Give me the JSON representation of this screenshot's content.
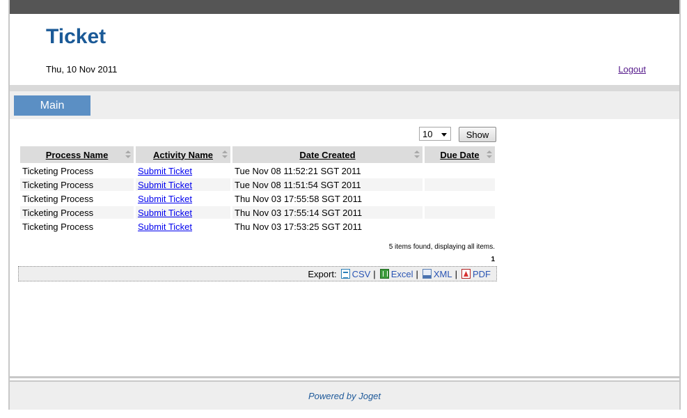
{
  "header": {
    "title": "Ticket",
    "date": "Thu, 10 Nov 2011",
    "logout_label": "Logout"
  },
  "menu": {
    "tabs": [
      {
        "label": "Main"
      }
    ]
  },
  "controls": {
    "page_size": "10",
    "show_label": "Show"
  },
  "table": {
    "columns": [
      "Process Name",
      "Activity Name",
      "Date Created",
      "Due Date"
    ],
    "rows": [
      {
        "process": "Ticketing Process",
        "activity": "Submit Ticket",
        "created": "Tue Nov 08 11:52:21 SGT 2011",
        "due": ""
      },
      {
        "process": "Ticketing Process",
        "activity": "Submit Ticket",
        "created": "Tue Nov 08 11:51:54 SGT 2011",
        "due": ""
      },
      {
        "process": "Ticketing Process",
        "activity": "Submit Ticket",
        "created": "Thu Nov 03 17:55:58 SGT 2011",
        "due": ""
      },
      {
        "process": "Ticketing Process",
        "activity": "Submit Ticket",
        "created": "Thu Nov 03 17:55:14 SGT 2011",
        "due": ""
      },
      {
        "process": "Ticketing Process",
        "activity": "Submit Ticket",
        "created": "Thu Nov 03 17:53:25 SGT 2011",
        "due": ""
      }
    ],
    "items_found": "5 items found, displaying all items.",
    "page": "1"
  },
  "export": {
    "label": "Export:",
    "separator": "|",
    "options": [
      {
        "label": "CSV",
        "icon": "csv-icon"
      },
      {
        "label": "Excel",
        "icon": "excel-icon"
      },
      {
        "label": "XML",
        "icon": "xml-icon"
      },
      {
        "label": "PDF",
        "icon": "pdf-icon"
      }
    ]
  },
  "footer": {
    "text": "Powered by Joget"
  },
  "colors": {
    "topbar": "#555555",
    "title": "#1b5a97",
    "tab_active": "#5b8fc4",
    "header_cell": "#dcdcdc"
  }
}
